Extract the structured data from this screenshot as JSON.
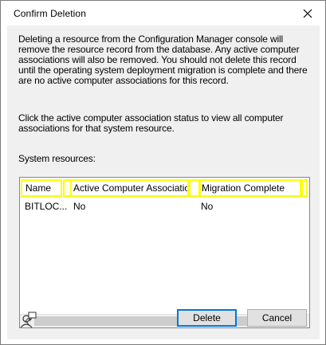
{
  "window": {
    "title": "Confirm Deletion"
  },
  "message": {
    "warning": "Deleting a resource from the Configuration Manager console will remove the resource record from the database. Any active computer associations will also be removed. You should not delete this record until the operating system deployment migration is complete and there are no active computer associations for this record.",
    "instruction": "Click the active computer association status to view all computer associations for that system resource."
  },
  "list": {
    "label": "System resources:",
    "columns": [
      "Name",
      "Active Computer Association",
      "Migration Complete"
    ],
    "rows": [
      [
        "BITLOC...",
        "No",
        "No"
      ]
    ]
  },
  "buttons": {
    "delete": "Delete",
    "cancel": "Cancel"
  },
  "icons": {
    "close": "close-icon",
    "help": "user-help-icon",
    "scroll_left": "chevron-left-icon",
    "scroll_right": "chevron-right-icon"
  },
  "colors": {
    "highlight": "#ffff00",
    "default_button_border": "#0078d7"
  }
}
